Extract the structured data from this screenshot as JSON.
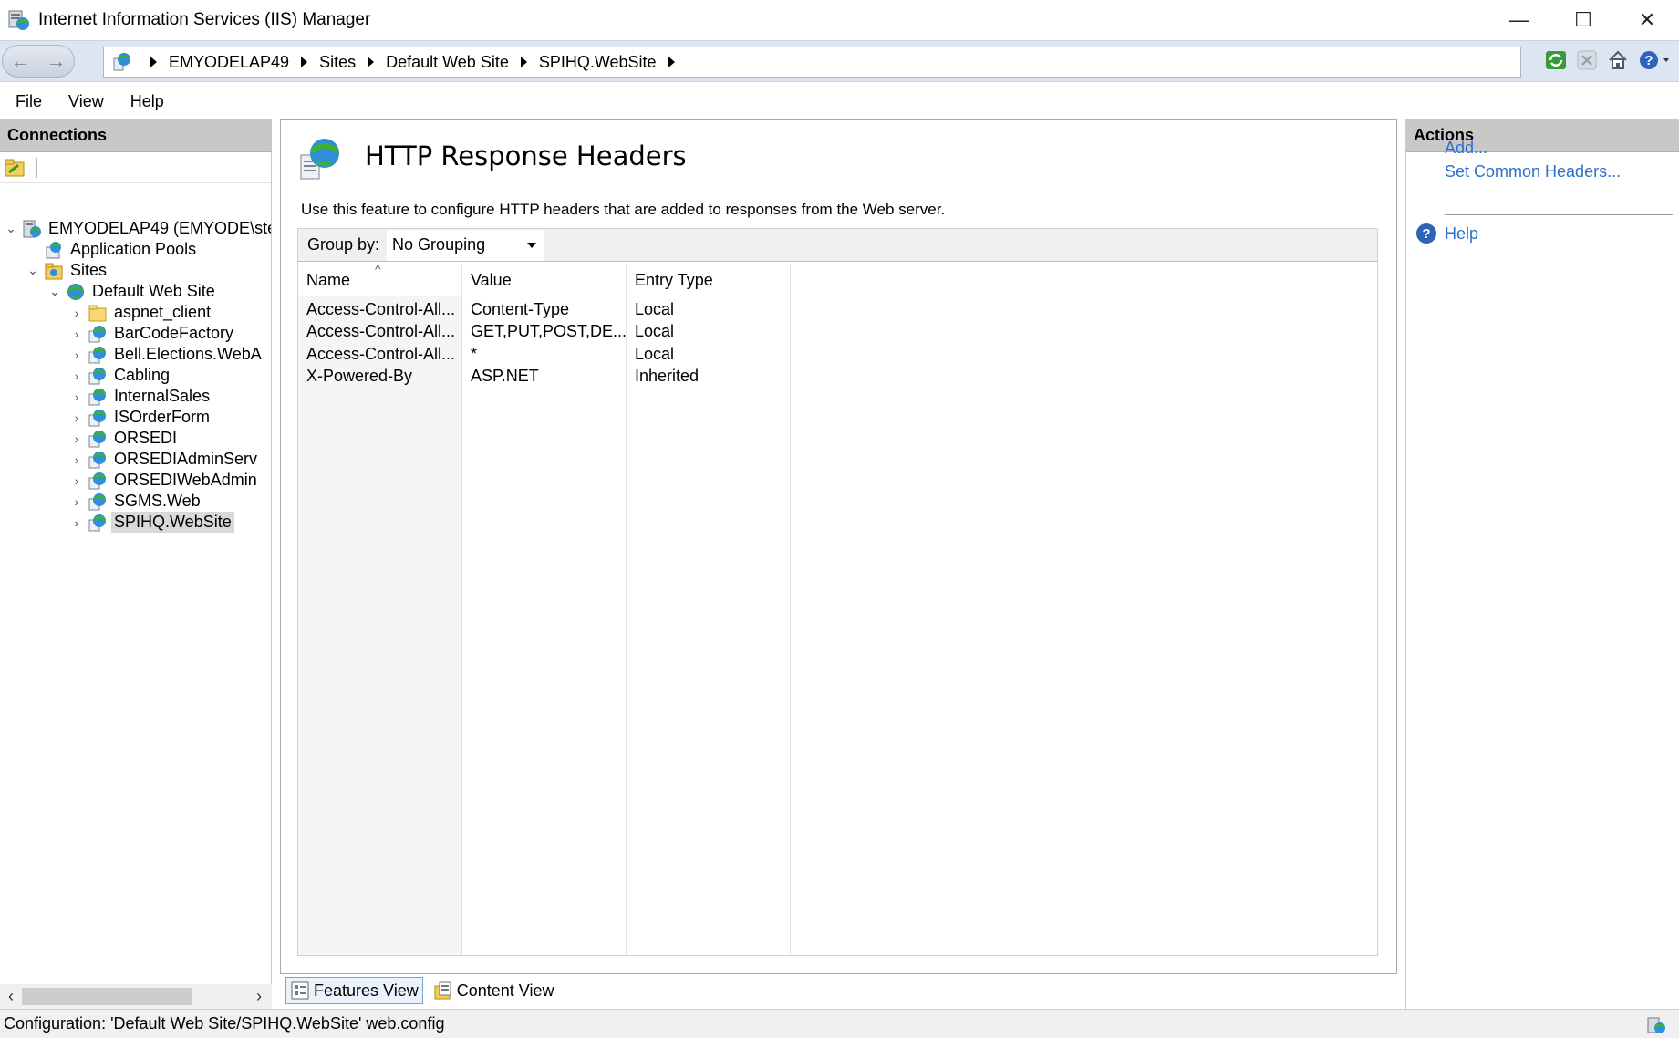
{
  "window": {
    "title": "Internet Information Services (IIS) Manager",
    "minimize": "—",
    "maximize": "☐",
    "close": "✕"
  },
  "address": {
    "back": "←",
    "forward": "→",
    "crumbs": [
      "EMYODELAP49",
      "Sites",
      "Default Web Site",
      "SPIHQ.WebSite"
    ]
  },
  "menu": [
    "File",
    "View",
    "Help"
  ],
  "connections": {
    "header": "Connections",
    "tree": [
      {
        "label": "EMYODELAP49 (EMYODE\\ste",
        "icon": "server-icon",
        "expanded": true
      },
      {
        "label": "Application Pools",
        "icon": "app-pools-icon"
      },
      {
        "label": "Sites",
        "icon": "sites-folder-icon",
        "expanded": true
      },
      {
        "label": "Default Web Site",
        "icon": "globe-icon",
        "expanded": true
      },
      {
        "label": "aspnet_client",
        "icon": "folder-icon"
      },
      {
        "label": "BarCodeFactory",
        "icon": "web-app-icon"
      },
      {
        "label": "Bell.Elections.WebA",
        "icon": "web-app-icon"
      },
      {
        "label": "Cabling",
        "icon": "web-app-icon"
      },
      {
        "label": "InternalSales",
        "icon": "web-app-icon"
      },
      {
        "label": "ISOrderForm",
        "icon": "web-app-icon"
      },
      {
        "label": "ORSEDI",
        "icon": "web-app-icon"
      },
      {
        "label": "ORSEDIAdminServ",
        "icon": "web-app-icon"
      },
      {
        "label": "ORSEDIWebAdmin",
        "icon": "web-app-icon"
      },
      {
        "label": "SGMS.Web",
        "icon": "web-app-icon"
      },
      {
        "label": "SPIHQ.WebSite",
        "icon": "web-app-icon",
        "selected": true
      }
    ]
  },
  "feature": {
    "title": "HTTP Response Headers",
    "description": "Use this feature to configure HTTP headers that are added to responses from the Web server.",
    "group_by_label": "Group by:",
    "group_by_value": "No Grouping",
    "columns": [
      "Name",
      "Value",
      "Entry Type"
    ],
    "rows": [
      [
        "Access-Control-All...",
        "Content-Type",
        "Local"
      ],
      [
        "Access-Control-All...",
        "GET,PUT,POST,DE...",
        "Local"
      ],
      [
        "Access-Control-All...",
        "*",
        "Local"
      ],
      [
        "X-Powered-By",
        "ASP.NET",
        "Inherited"
      ]
    ]
  },
  "view_tabs": [
    "Features View",
    "Content View"
  ],
  "actions": {
    "header": "Actions",
    "add": "Add...",
    "set_common": "Set Common Headers...",
    "help": "Help"
  },
  "status": {
    "text": "Configuration: 'Default Web Site/SPIHQ.WebSite' web.config"
  },
  "colors": {
    "link": "#2a6fcf",
    "panel_header": "#c8c8c8",
    "address_bar": "#dce6f2"
  }
}
